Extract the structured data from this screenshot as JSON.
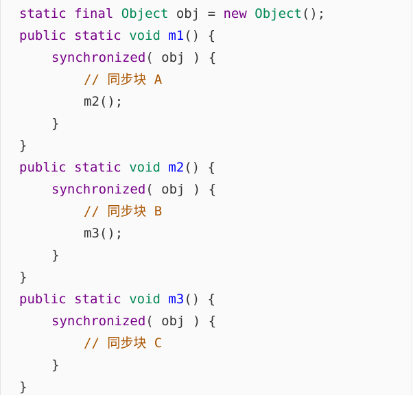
{
  "code": {
    "colors": {
      "keyword": "#770088",
      "type": "#008855",
      "function_name": "#0000ff",
      "comment": "#aa5500",
      "text": "#333333",
      "background": "#fafafa"
    },
    "line1": {
      "kw1": "static",
      "kw2": "final",
      "type": "Object",
      "rest1": "obj = ",
      "kw3": "new",
      "type2": "Object",
      "rest2": "();"
    },
    "m1": {
      "kw1": "public",
      "kw2": "static",
      "type": "void",
      "name": "m1",
      "tail": "() {",
      "sync_kw": "synchronized",
      "sync_rest": "( obj ) {",
      "comment": "// 同步块 A",
      "call": "m2();",
      "close_inner": "}",
      "close_outer": "}"
    },
    "m2": {
      "kw1": "public",
      "kw2": "static",
      "type": "void",
      "name": "m2",
      "tail": "() {",
      "sync_kw": "synchronized",
      "sync_rest": "( obj ) {",
      "comment": "// 同步块 B",
      "call": "m3();",
      "close_inner": "}",
      "close_outer": "}"
    },
    "m3": {
      "kw1": "public",
      "kw2": "static",
      "type": "void",
      "name": "m3",
      "tail": "() {",
      "sync_kw": "synchronized",
      "sync_rest": "( obj ) {",
      "comment": "// 同步块 C",
      "close_inner": "}",
      "close_outer": "}"
    }
  }
}
